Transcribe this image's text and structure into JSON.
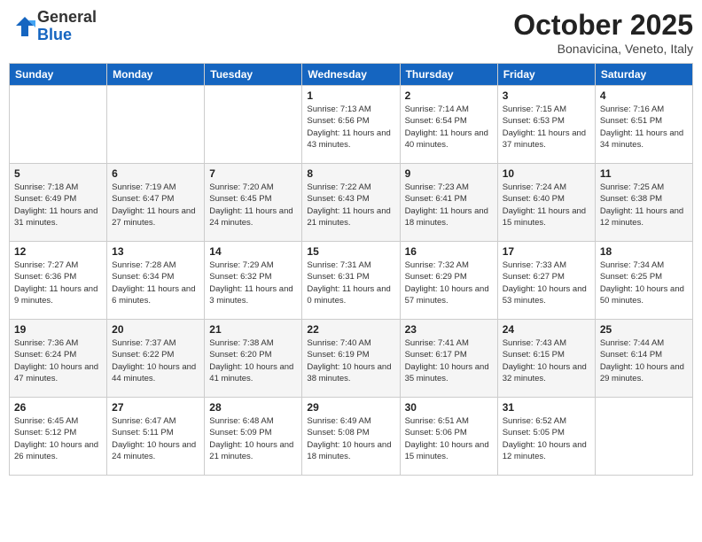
{
  "logo": {
    "general": "General",
    "blue": "Blue"
  },
  "header": {
    "month": "October 2025",
    "location": "Bonavicina, Veneto, Italy"
  },
  "days_of_week": [
    "Sunday",
    "Monday",
    "Tuesday",
    "Wednesday",
    "Thursday",
    "Friday",
    "Saturday"
  ],
  "weeks": [
    [
      {
        "day": "",
        "info": ""
      },
      {
        "day": "",
        "info": ""
      },
      {
        "day": "",
        "info": ""
      },
      {
        "day": "1",
        "info": "Sunrise: 7:13 AM\nSunset: 6:56 PM\nDaylight: 11 hours and 43 minutes."
      },
      {
        "day": "2",
        "info": "Sunrise: 7:14 AM\nSunset: 6:54 PM\nDaylight: 11 hours and 40 minutes."
      },
      {
        "day": "3",
        "info": "Sunrise: 7:15 AM\nSunset: 6:53 PM\nDaylight: 11 hours and 37 minutes."
      },
      {
        "day": "4",
        "info": "Sunrise: 7:16 AM\nSunset: 6:51 PM\nDaylight: 11 hours and 34 minutes."
      }
    ],
    [
      {
        "day": "5",
        "info": "Sunrise: 7:18 AM\nSunset: 6:49 PM\nDaylight: 11 hours and 31 minutes."
      },
      {
        "day": "6",
        "info": "Sunrise: 7:19 AM\nSunset: 6:47 PM\nDaylight: 11 hours and 27 minutes."
      },
      {
        "day": "7",
        "info": "Sunrise: 7:20 AM\nSunset: 6:45 PM\nDaylight: 11 hours and 24 minutes."
      },
      {
        "day": "8",
        "info": "Sunrise: 7:22 AM\nSunset: 6:43 PM\nDaylight: 11 hours and 21 minutes."
      },
      {
        "day": "9",
        "info": "Sunrise: 7:23 AM\nSunset: 6:41 PM\nDaylight: 11 hours and 18 minutes."
      },
      {
        "day": "10",
        "info": "Sunrise: 7:24 AM\nSunset: 6:40 PM\nDaylight: 11 hours and 15 minutes."
      },
      {
        "day": "11",
        "info": "Sunrise: 7:25 AM\nSunset: 6:38 PM\nDaylight: 11 hours and 12 minutes."
      }
    ],
    [
      {
        "day": "12",
        "info": "Sunrise: 7:27 AM\nSunset: 6:36 PM\nDaylight: 11 hours and 9 minutes."
      },
      {
        "day": "13",
        "info": "Sunrise: 7:28 AM\nSunset: 6:34 PM\nDaylight: 11 hours and 6 minutes."
      },
      {
        "day": "14",
        "info": "Sunrise: 7:29 AM\nSunset: 6:32 PM\nDaylight: 11 hours and 3 minutes."
      },
      {
        "day": "15",
        "info": "Sunrise: 7:31 AM\nSunset: 6:31 PM\nDaylight: 11 hours and 0 minutes."
      },
      {
        "day": "16",
        "info": "Sunrise: 7:32 AM\nSunset: 6:29 PM\nDaylight: 10 hours and 57 minutes."
      },
      {
        "day": "17",
        "info": "Sunrise: 7:33 AM\nSunset: 6:27 PM\nDaylight: 10 hours and 53 minutes."
      },
      {
        "day": "18",
        "info": "Sunrise: 7:34 AM\nSunset: 6:25 PM\nDaylight: 10 hours and 50 minutes."
      }
    ],
    [
      {
        "day": "19",
        "info": "Sunrise: 7:36 AM\nSunset: 6:24 PM\nDaylight: 10 hours and 47 minutes."
      },
      {
        "day": "20",
        "info": "Sunrise: 7:37 AM\nSunset: 6:22 PM\nDaylight: 10 hours and 44 minutes."
      },
      {
        "day": "21",
        "info": "Sunrise: 7:38 AM\nSunset: 6:20 PM\nDaylight: 10 hours and 41 minutes."
      },
      {
        "day": "22",
        "info": "Sunrise: 7:40 AM\nSunset: 6:19 PM\nDaylight: 10 hours and 38 minutes."
      },
      {
        "day": "23",
        "info": "Sunrise: 7:41 AM\nSunset: 6:17 PM\nDaylight: 10 hours and 35 minutes."
      },
      {
        "day": "24",
        "info": "Sunrise: 7:43 AM\nSunset: 6:15 PM\nDaylight: 10 hours and 32 minutes."
      },
      {
        "day": "25",
        "info": "Sunrise: 7:44 AM\nSunset: 6:14 PM\nDaylight: 10 hours and 29 minutes."
      }
    ],
    [
      {
        "day": "26",
        "info": "Sunrise: 6:45 AM\nSunset: 5:12 PM\nDaylight: 10 hours and 26 minutes."
      },
      {
        "day": "27",
        "info": "Sunrise: 6:47 AM\nSunset: 5:11 PM\nDaylight: 10 hours and 24 minutes."
      },
      {
        "day": "28",
        "info": "Sunrise: 6:48 AM\nSunset: 5:09 PM\nDaylight: 10 hours and 21 minutes."
      },
      {
        "day": "29",
        "info": "Sunrise: 6:49 AM\nSunset: 5:08 PM\nDaylight: 10 hours and 18 minutes."
      },
      {
        "day": "30",
        "info": "Sunrise: 6:51 AM\nSunset: 5:06 PM\nDaylight: 10 hours and 15 minutes."
      },
      {
        "day": "31",
        "info": "Sunrise: 6:52 AM\nSunset: 5:05 PM\nDaylight: 10 hours and 12 minutes."
      },
      {
        "day": "",
        "info": ""
      }
    ]
  ]
}
